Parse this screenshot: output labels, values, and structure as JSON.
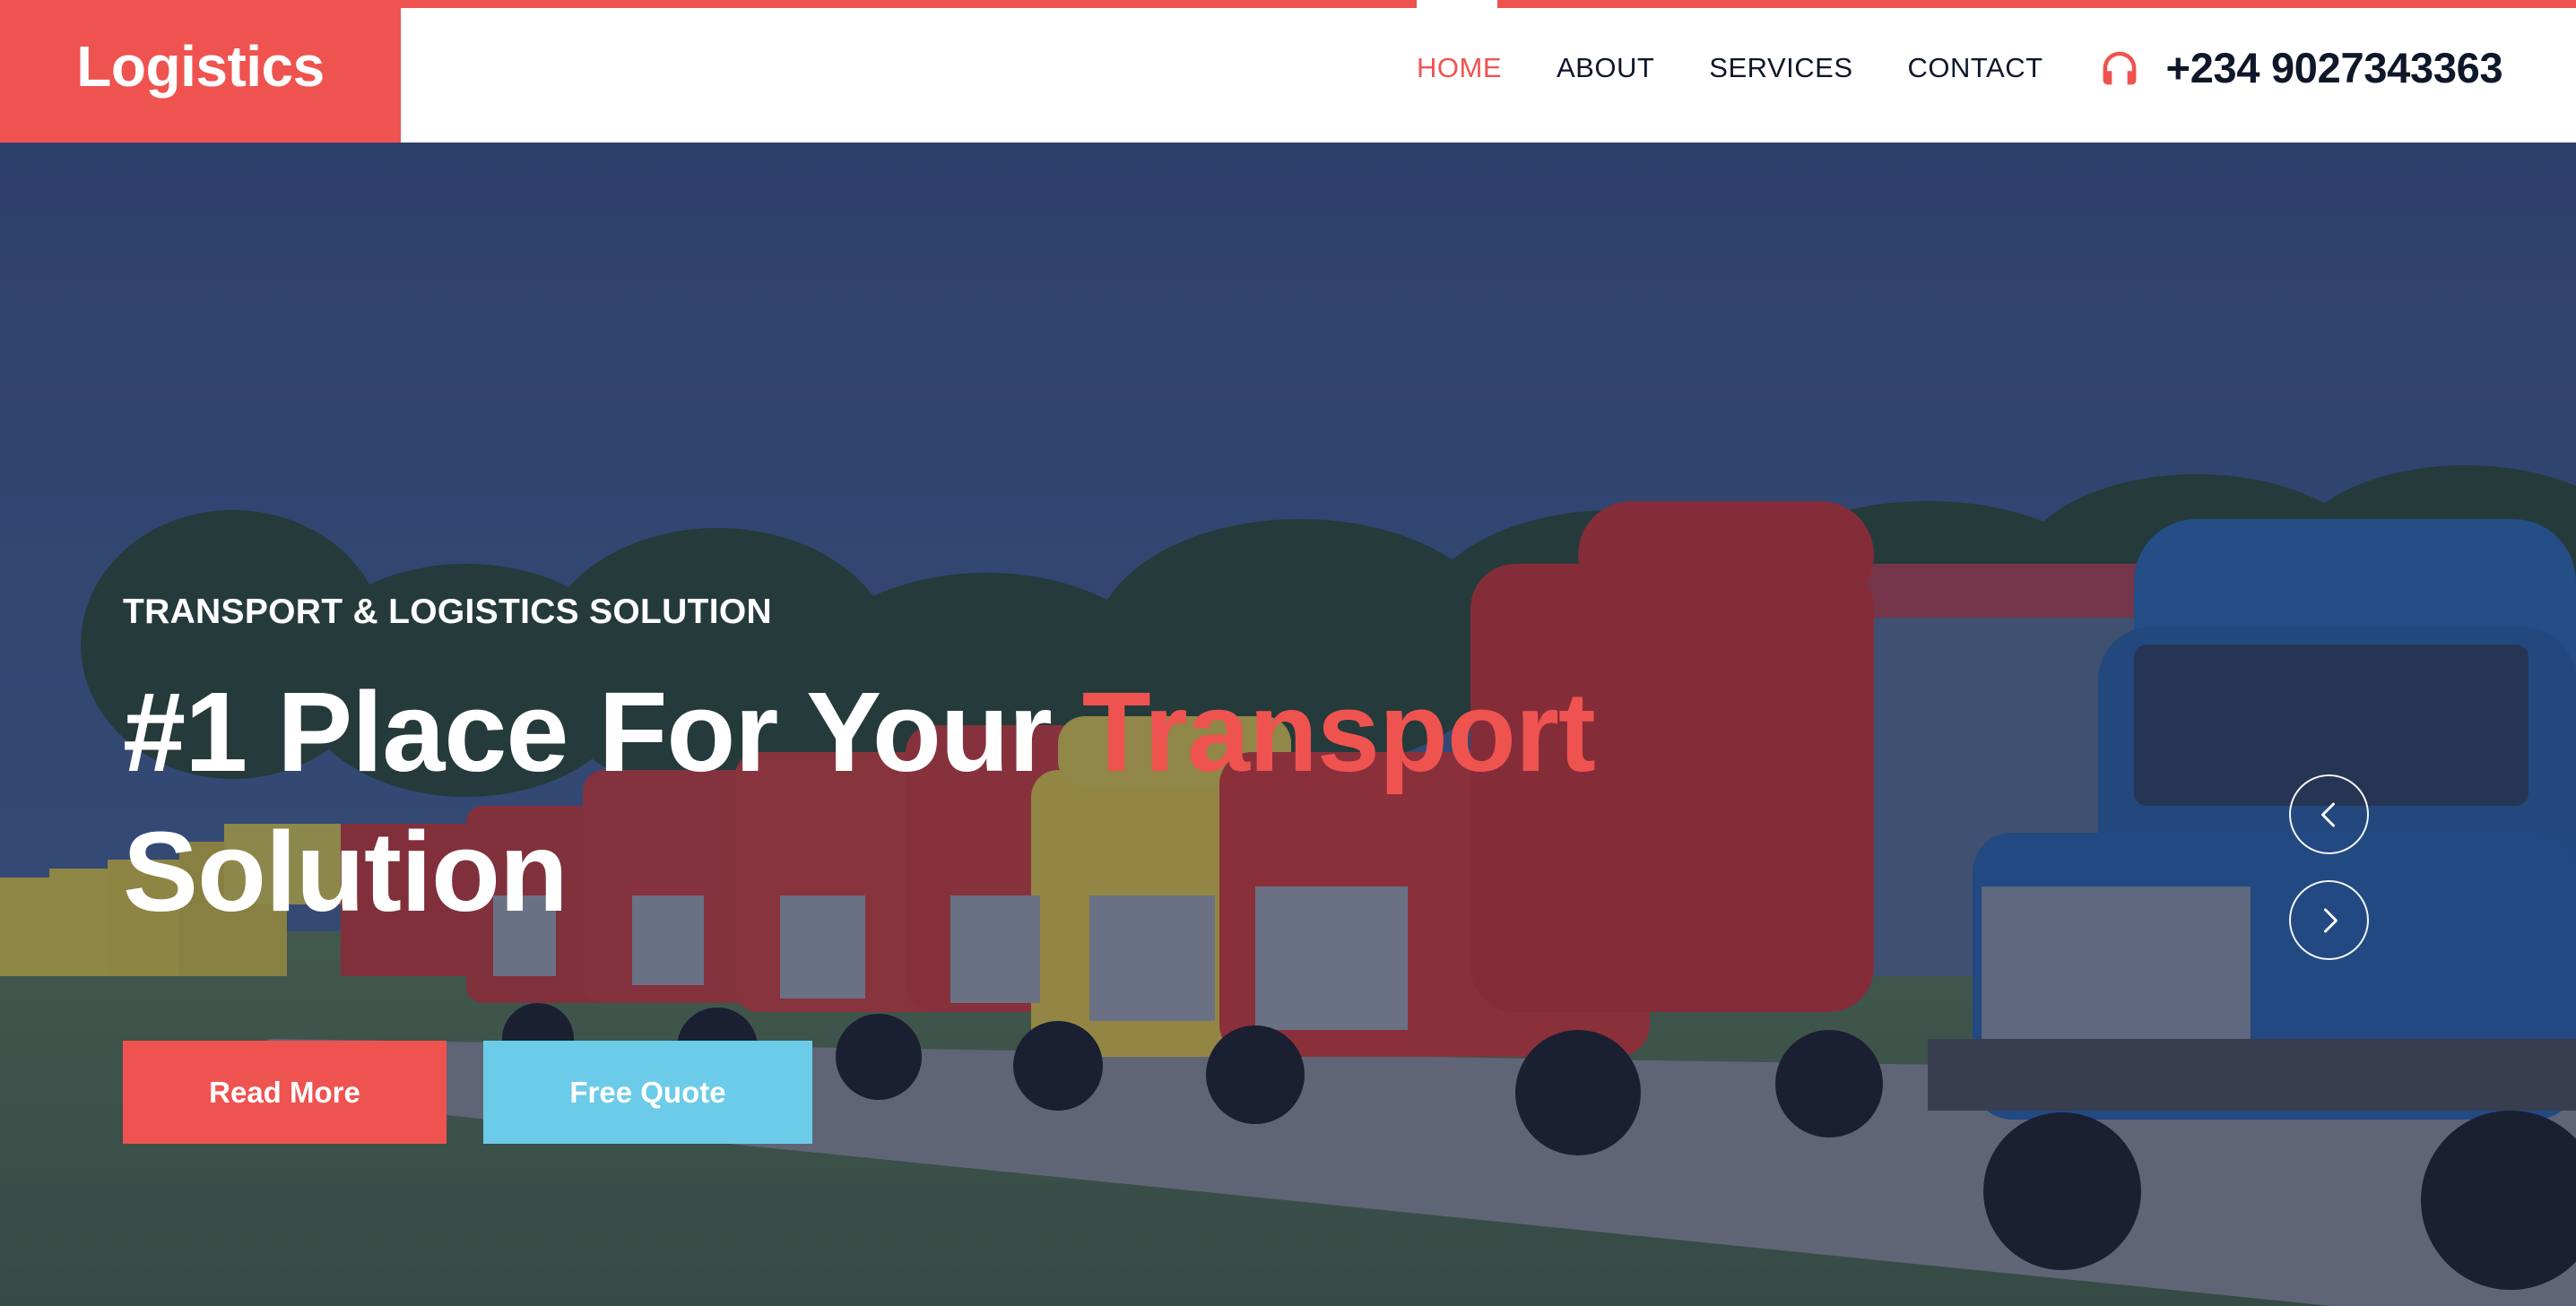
{
  "brand": {
    "name": "Logistics"
  },
  "nav": {
    "items": [
      {
        "label": "HOME",
        "active": true
      },
      {
        "label": "ABOUT",
        "active": false
      },
      {
        "label": "SERVICES",
        "active": false
      },
      {
        "label": "CONTACT",
        "active": false
      }
    ],
    "phone": {
      "icon": "headphones-icon",
      "number": "+234 9027343363"
    }
  },
  "hero": {
    "kicker": "TRANSPORT & LOGISTICS SOLUTION",
    "title_before": "#1 Place For Your ",
    "title_accent": "Transport",
    "title_after": "Solution",
    "primary_button": "Read More",
    "secondary_button": "Free Quote",
    "carousel": {
      "prev_icon": "chevron-left-icon",
      "next_icon": "chevron-right-icon"
    }
  },
  "colors": {
    "accent": "#ef5350",
    "secondary": "#6ccbe8",
    "nav_text": "#0f172a",
    "overlay": "#16214e"
  }
}
